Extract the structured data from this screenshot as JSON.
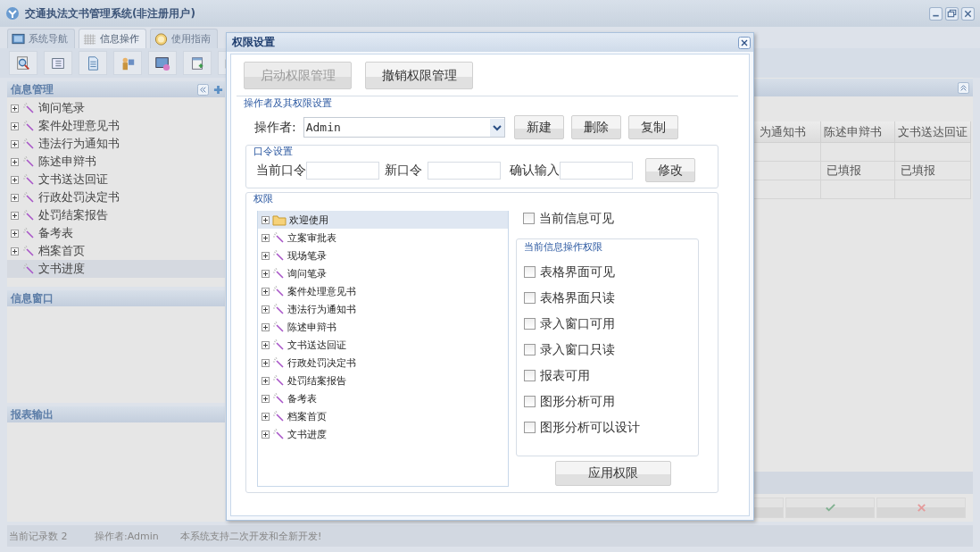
{
  "window": {
    "title": "交通执法文书管理系统(非注册用户)"
  },
  "tabs": [
    {
      "label": "系统导航",
      "selected": false
    },
    {
      "label": "信息操作",
      "selected": true
    },
    {
      "label": "使用指南",
      "selected": false
    }
  ],
  "left_panel": {
    "sections": [
      {
        "title": "信息管理",
        "items": [
          {
            "label": "询问笔录",
            "selected": false
          },
          {
            "label": "案件处理意见书",
            "selected": false
          },
          {
            "label": "违法行为通知书",
            "selected": false
          },
          {
            "label": "陈述申辩书",
            "selected": false
          },
          {
            "label": "文书送达回证",
            "selected": false
          },
          {
            "label": "行政处罚决定书",
            "selected": false
          },
          {
            "label": "处罚结案报告",
            "selected": false
          },
          {
            "label": "备考表",
            "selected": false
          },
          {
            "label": "档案首页",
            "selected": false
          },
          {
            "label": "文书进度",
            "selected": true
          }
        ]
      },
      {
        "title": "信息窗口"
      },
      {
        "title": "报表输出"
      }
    ]
  },
  "table": {
    "columns": [
      "为通知书",
      "陈述申辩书",
      "文书送达回证"
    ],
    "rows": [
      {
        "cells": [
          "",
          "",
          ""
        ]
      },
      {
        "cells": [
          "",
          "已填报",
          "已填报"
        ]
      },
      {
        "cells": [
          "",
          "",
          ""
        ]
      }
    ]
  },
  "status_bar": [
    "当前记录数 2",
    "操作者:Admin",
    "本系统支持二次开发和全新开发!"
  ],
  "dialog": {
    "title": "权限设置",
    "buttons": [
      {
        "label": "启动权限管理",
        "disabled": true
      },
      {
        "label": "撤销权限管理",
        "disabled": false
      }
    ],
    "operator_section": {
      "title": "操作者及其权限设置",
      "label": "操作者:",
      "value": "Admin",
      "buttons": [
        "新建",
        "删除",
        "复制"
      ]
    },
    "password_section": {
      "title": "口令设置",
      "fields": [
        "当前口令",
        "新口令",
        "确认输入"
      ],
      "button": "修改"
    },
    "permissions": {
      "title": "权限",
      "tree": [
        {
          "label": "欢迎使用",
          "kind": "folder",
          "selected": true
        },
        {
          "label": "立案审批表",
          "kind": "doc",
          "selected": false
        },
        {
          "label": "现场笔录",
          "kind": "doc",
          "selected": false
        },
        {
          "label": "询问笔录",
          "kind": "doc",
          "selected": false
        },
        {
          "label": "案件处理意见书",
          "kind": "doc",
          "selected": false
        },
        {
          "label": "违法行为通知书",
          "kind": "doc",
          "selected": false
        },
        {
          "label": "陈述申辩书",
          "kind": "doc",
          "selected": false
        },
        {
          "label": "文书送达回证",
          "kind": "doc",
          "selected": false
        },
        {
          "label": "行政处罚决定书",
          "kind": "doc",
          "selected": false
        },
        {
          "label": "处罚结案报告",
          "kind": "doc",
          "selected": false
        },
        {
          "label": "备考表",
          "kind": "doc",
          "selected": false
        },
        {
          "label": "档案首页",
          "kind": "doc",
          "selected": false
        },
        {
          "label": "文书进度",
          "kind": "doc",
          "selected": false
        }
      ],
      "visible_checkbox": {
        "label": "当前信息可见",
        "checked": false
      },
      "operations": {
        "title": "当前信息操作权限",
        "checkboxes": [
          {
            "label": "表格界面可见",
            "checked": false
          },
          {
            "label": "表格界面只读",
            "checked": false
          },
          {
            "label": "录入窗口可用",
            "checked": false
          },
          {
            "label": "录入窗口只读",
            "checked": false
          },
          {
            "label": "报表可用",
            "checked": false
          },
          {
            "label": "图形分析可用",
            "checked": false
          },
          {
            "label": "图形分析可以设计",
            "checked": false
          }
        ]
      },
      "apply_button": "应用权限"
    }
  }
}
